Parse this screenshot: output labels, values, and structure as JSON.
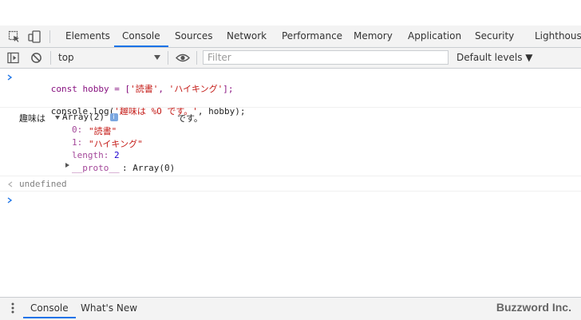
{
  "tabs": [
    {
      "label": "Elements"
    },
    {
      "label": "Console"
    },
    {
      "label": "Sources"
    },
    {
      "label": "Network"
    },
    {
      "label": "Performance"
    },
    {
      "label": "Memory"
    },
    {
      "label": "Application"
    },
    {
      "label": "Security"
    },
    {
      "label": "Lighthouse"
    }
  ],
  "toolbar": {
    "context": "top",
    "filter_placeholder": "Filter",
    "levels": "Default levels ▼"
  },
  "console": {
    "input1_code": {
      "a": "const hobby = [",
      "b": "'読書'",
      "c": ", ",
      "d": "'ハイキング'",
      "e": "];"
    },
    "input2_code": {
      "a": "console.log(",
      "b": "'趣味は %O です。'",
      "c": ", hobby);"
    },
    "output_prefix": "趣味は",
    "output_array": "Array(2)",
    "output_suffix": "です。",
    "info_badge": "i",
    "item0_key": "0:",
    "item0_val": "\"読書\"",
    "item1_key": "1:",
    "item1_val": "\"ハイキング\"",
    "length_key": "length:",
    "length_val": "2",
    "proto_key": "__proto__",
    "proto_val": ": Array(0)",
    "result": "undefined"
  },
  "bottom": {
    "tab_console": "Console",
    "tab_whats_new": "What's New",
    "watermark": "Buzzword Inc."
  },
  "colors": {
    "accent": "#1a73e8"
  }
}
